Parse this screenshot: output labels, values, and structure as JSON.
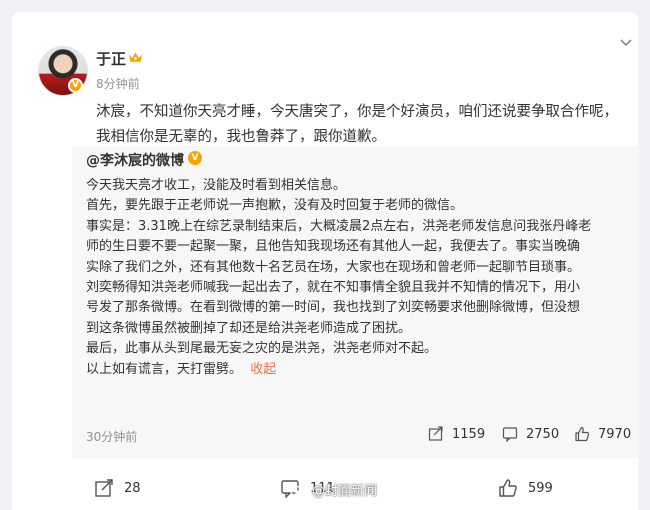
{
  "post": {
    "author": "于正",
    "time": "8分钟前",
    "text_line1": "沐宸，不知道你天亮才睡，今天唐突了，你是个好演员，咱们还说要争取合作呢，",
    "text_line2": "我相信你是无辜的，我也鲁莽了，跟你道歉。"
  },
  "repost": {
    "author": "@李沐宸的微博",
    "lines": [
      "今天我天亮才收工，没能及时看到相关信息。",
      "首先，要先跟于正老师说一声抱歉，没有及时回复于老师的微信。",
      "事实是：3.31晚上在综艺录制结束后，大概凌晨2点左右，洪尧老师发信息问我张丹峰老",
      "师的生日要不要一起聚一聚，且他告知我现场还有其他人一起，我便去了。事实当晚确",
      "实除了我们之外，还有其他数十名艺员在场，大家也在现场和曾老师一起聊节目琐事。",
      "刘奕畅得知洪尧老师喊我一起出去了，就在不知事情全貌且我并不知情的情况下，用小",
      "号发了那条微博。在看到微博的第一时间，我也找到了刘奕畅要求他删除微博，但没想",
      "到这条微博虽然被删掉了却还是给洪尧老师造成了困扰。",
      "最后，此事从头到尾最无妄之灾的是洪尧，洪尧老师对不起。"
    ],
    "last_line": "以上如有谎言，天打雷劈。",
    "collapse_label": "收起",
    "time": "30分钟前",
    "shares": "1159",
    "comments": "2750",
    "likes": "7970"
  },
  "footer": {
    "shares": "28",
    "comments": "111",
    "likes": "599"
  },
  "watermark": "@封面新闻",
  "colors": {
    "background": "#f1f2f5",
    "repost_background": "#f7f7f8",
    "link_orange": "#eb7350",
    "verified_badge": "#f7a400",
    "muted": "#939393"
  }
}
